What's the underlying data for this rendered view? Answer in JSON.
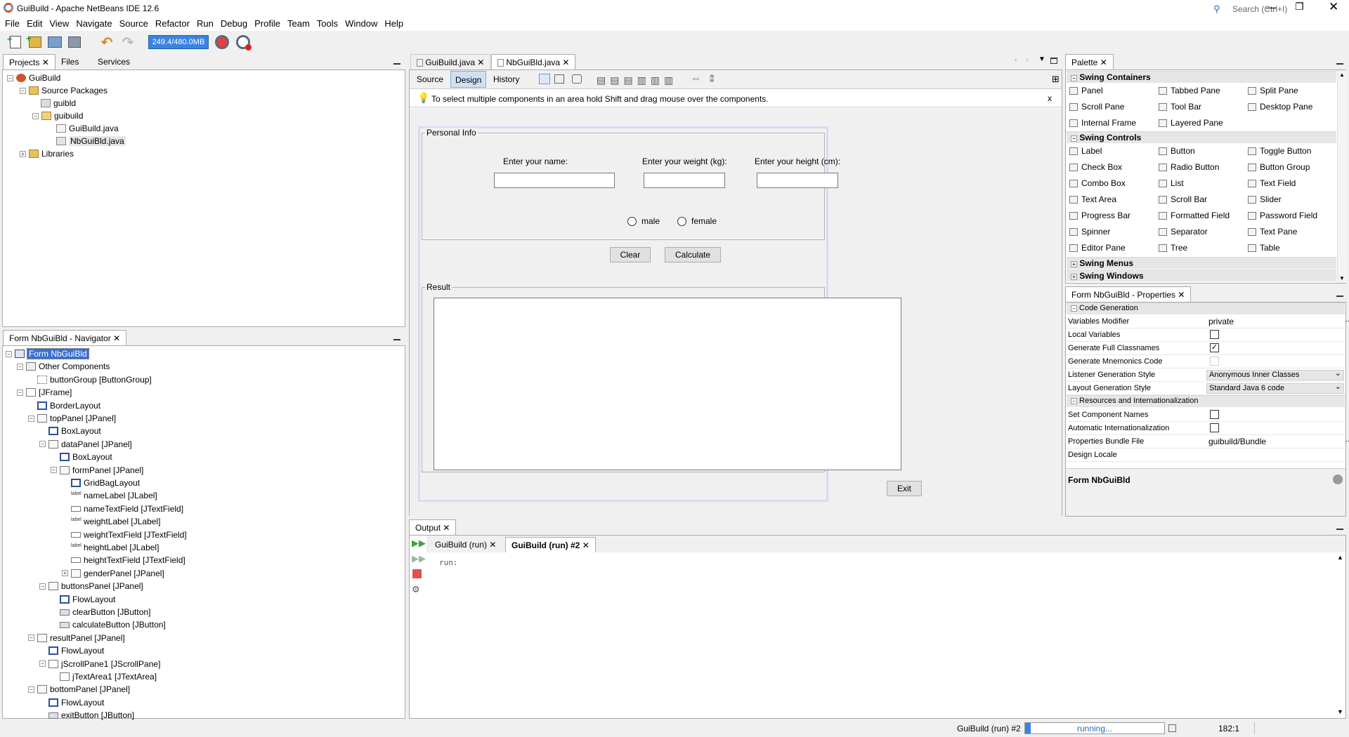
{
  "window": {
    "title": "GuiBuild - Apache NetBeans IDE 12.6",
    "search_placeholder": "Search (Ctrl+I)"
  },
  "menus": [
    "File",
    "Edit",
    "View",
    "Navigate",
    "Source",
    "Refactor",
    "Run",
    "Debug",
    "Profile",
    "Team",
    "Tools",
    "Window",
    "Help"
  ],
  "toolbar": {
    "memory": "249.4/480.0MB"
  },
  "projects": {
    "tabs": [
      "Projects",
      "Files",
      "Services"
    ],
    "tree": [
      "GuiBuild",
      "Source Packages",
      "guibld",
      "guibuild",
      "GuiBuild.java",
      "NbGuiBld.java",
      "Libraries"
    ]
  },
  "navigator": {
    "title": "Form NbGuiBld - Navigator",
    "tree": [
      "Form NbGuiBld",
      "Other Components",
      "buttonGroup [ButtonGroup]",
      "[JFrame]",
      "BorderLayout",
      "topPanel [JPanel]",
      "BoxLayout",
      "dataPanel [JPanel]",
      "BoxLayout",
      "formPanel [JPanel]",
      "GridBagLayout",
      "nameLabel [JLabel]",
      "nameTextField [JTextField]",
      "weightLabel [JLabel]",
      "weightTextField [JTextField]",
      "heightLabel [JLabel]",
      "heightTextField [JTextField]",
      "genderPanel [JPanel]",
      "buttonsPanel [JPanel]",
      "FlowLayout",
      "clearButton [JButton]",
      "calculateButton [JButton]",
      "resultPanel [JPanel]",
      "FlowLayout",
      "jScrollPane1 [JScrollPane]",
      "jTextArea1 [JTextArea]",
      "bottomPanel [JPanel]",
      "FlowLayout",
      "exitButton [JButton]"
    ]
  },
  "editor": {
    "tabs": [
      "GuiBuild.java",
      "NbGuiBld.java"
    ],
    "views": [
      "Source",
      "Design",
      "History"
    ],
    "hint": "To select multiple components in an area hold Shift and drag mouse over the components.",
    "hint_close": "x"
  },
  "form": {
    "personal_info": "Personal Info",
    "name_label": "Enter your name:",
    "weight_label": "Enter your weight (kg):",
    "height_label": "Enter your height (cm):",
    "male": "male",
    "female": "female",
    "clear": "Clear",
    "calculate": "Calculate",
    "result": "Result",
    "exit": "Exit"
  },
  "palette": {
    "title": "Palette",
    "groups": [
      "Swing Containers",
      "Swing Controls",
      "Swing Menus",
      "Swing Windows"
    ],
    "containers": [
      "Panel",
      "Tabbed Pane",
      "Split Pane",
      "Scroll Pane",
      "Tool Bar",
      "Desktop Pane",
      "Internal Frame",
      "Layered Pane"
    ],
    "controls": [
      "Label",
      "Button",
      "Toggle Button",
      "Check Box",
      "Radio Button",
      "Button Group",
      "Combo Box",
      "List",
      "Text Field",
      "Text Area",
      "Scroll Bar",
      "Slider",
      "Progress Bar",
      "Formatted Field",
      "Password Field",
      "Spinner",
      "Separator",
      "Text Pane",
      "Editor Pane",
      "Tree",
      "Table"
    ]
  },
  "properties": {
    "title": "Form NbGuiBld - Properties",
    "sections": [
      "Code Generation",
      "Resources and Internationalization"
    ],
    "rows": [
      {
        "key": "Variables Modifier",
        "value": "private"
      },
      {
        "key": "Local Variables",
        "value": ""
      },
      {
        "key": "Generate Full Classnames",
        "value": "✓"
      },
      {
        "key": "Generate Mnemonics Code",
        "value": ""
      },
      {
        "key": "Listener Generation Style",
        "value": "Anonymous Inner Classes"
      },
      {
        "key": "Layout Generation Style",
        "value": "Standard Java 6 code"
      },
      {
        "key": "Set Component Names",
        "value": ""
      },
      {
        "key": "Automatic Internationalization",
        "value": ""
      },
      {
        "key": "Properties Bundle File",
        "value": "guibuild/Bundle"
      },
      {
        "key": "Design Locale",
        "value": ""
      }
    ],
    "footer": "Form NbGuiBld"
  },
  "output": {
    "title": "Output",
    "tabs": [
      "GuiBuild (run)",
      "GuiBuild (run) #2"
    ],
    "text": "run:"
  },
  "status": {
    "task": "GuiBuild (run) #2",
    "progress": "running...",
    "position": "182:1"
  }
}
